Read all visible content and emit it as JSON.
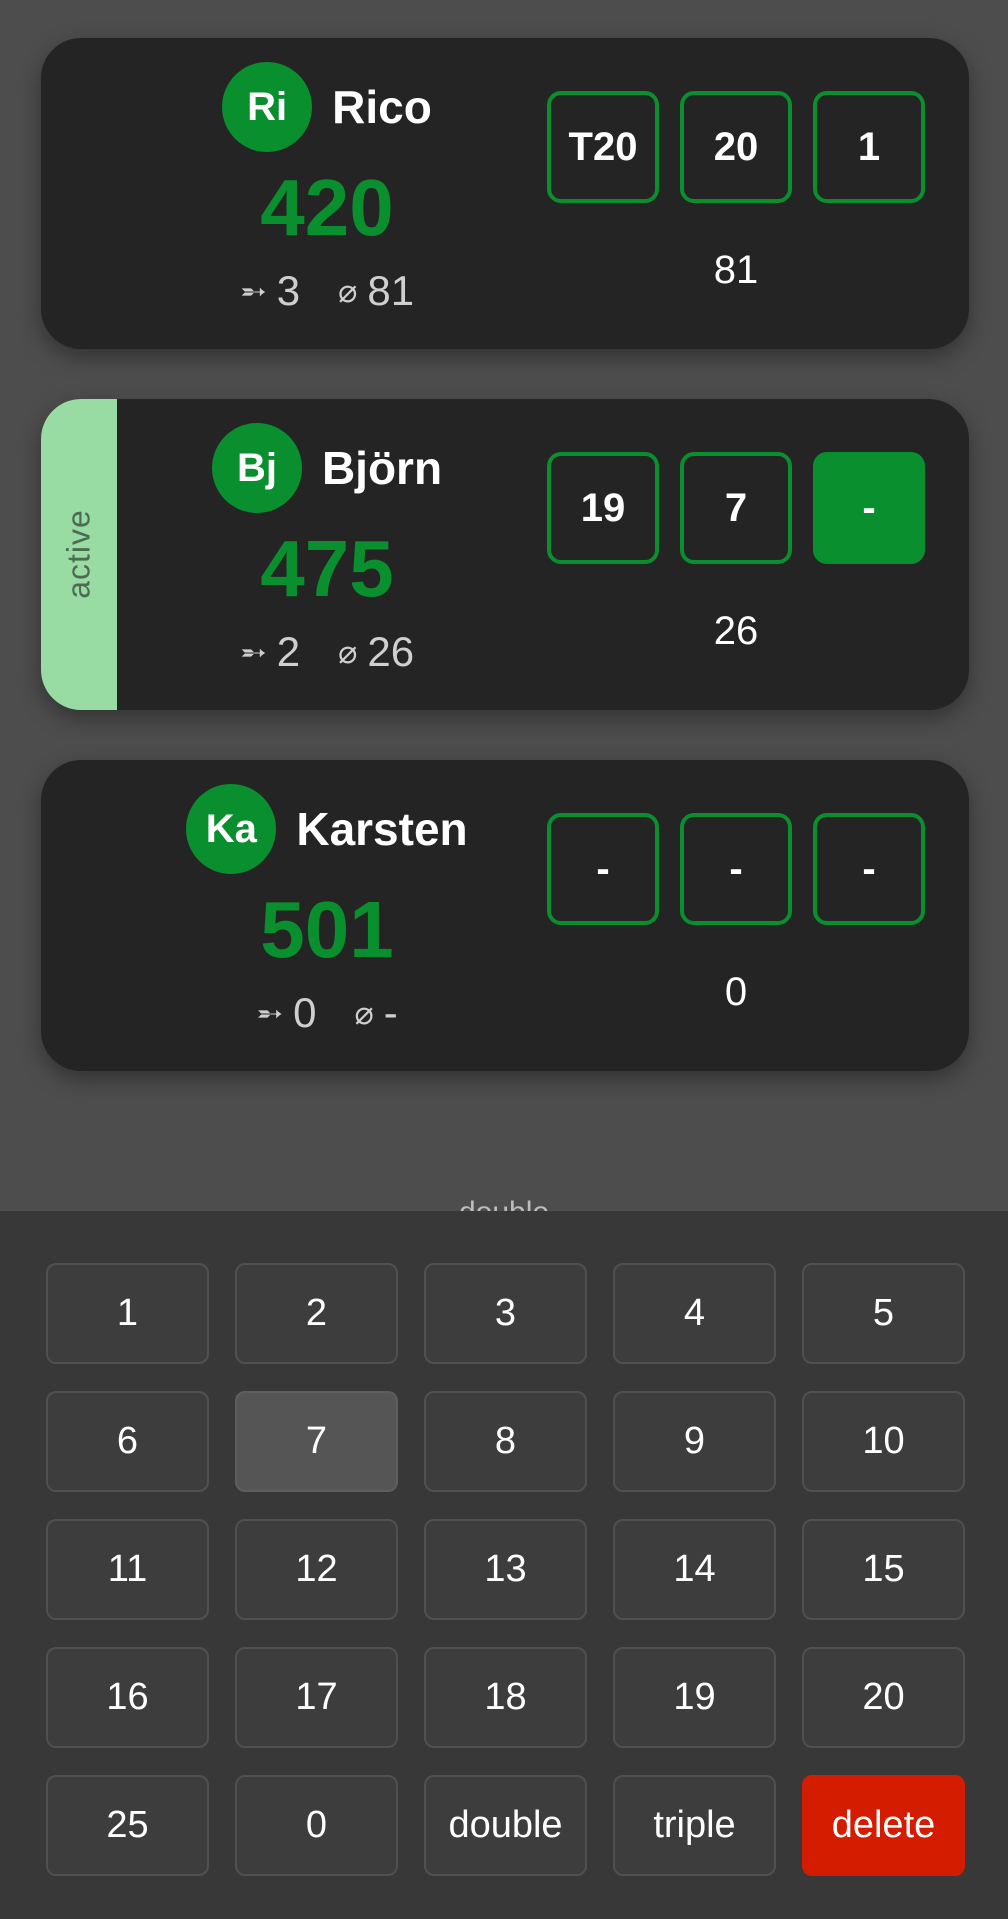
{
  "players": [
    {
      "initials": "Ri",
      "name": "Rico",
      "score": "420",
      "darts": "3",
      "average": "81",
      "active": false,
      "throws": [
        "T20",
        "20",
        "1"
      ],
      "round_total": "81"
    },
    {
      "initials": "Bj",
      "name": "Björn",
      "score": "475",
      "darts": "2",
      "average": "26",
      "active": true,
      "active_label": "active",
      "throws": [
        "19",
        "7",
        "-"
      ],
      "current_throw_index": 2,
      "round_total": "26"
    },
    {
      "initials": "Ka",
      "name": "Karsten",
      "score": "501",
      "darts": "0",
      "average": "-",
      "active": false,
      "throws": [
        "-",
        "-",
        "-"
      ],
      "round_total": "0"
    }
  ],
  "icons": {
    "darts": "dart-arrow-icon",
    "average": "average-diameter-icon"
  },
  "keypad": {
    "peek_label": "double",
    "keys": [
      "1",
      "2",
      "3",
      "4",
      "5",
      "6",
      "7",
      "8",
      "9",
      "10",
      "11",
      "12",
      "13",
      "14",
      "15",
      "16",
      "17",
      "18",
      "19",
      "20",
      "25",
      "0",
      "double",
      "triple",
      "delete"
    ],
    "highlighted_key": "7"
  },
  "colors": {
    "accent": "#0a8f2e",
    "active_strip": "#98dca4",
    "delete": "#d41c00",
    "card": "#242424",
    "background": "#4d4d4d"
  }
}
